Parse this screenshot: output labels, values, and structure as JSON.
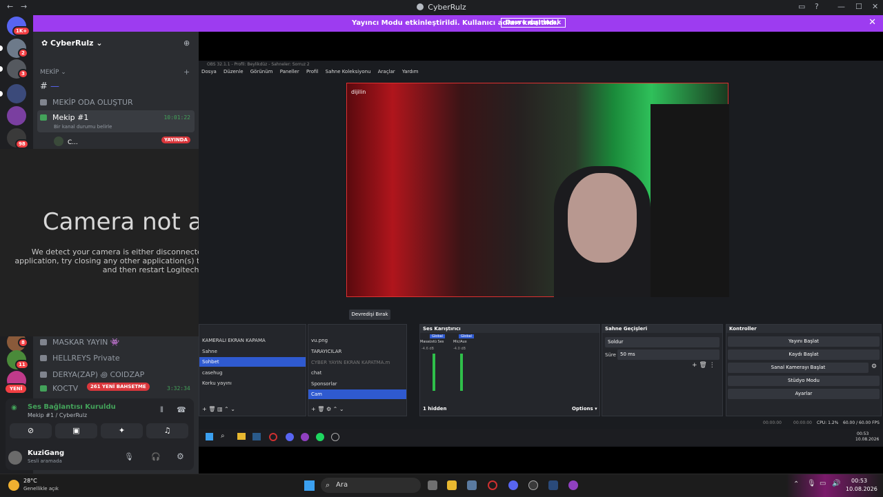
{
  "window": {
    "title": "CyberRulz"
  },
  "banner": {
    "text": "Yayıncı Modu etkinleştirildi. Kullanıcı adları kısaltıldı.",
    "button": "Devre dışı bırak"
  },
  "rail": {
    "badges": [
      "1K+",
      "2",
      "3",
      "8",
      "11",
      "98"
    ],
    "yeni": "YENİ"
  },
  "server": {
    "name": "CyberRulz",
    "category": "MEKİP",
    "hash_channel": "—",
    "channels": [
      {
        "label": "MEKİP ODA OLUŞTUR"
      },
      {
        "label": "Mekip #1",
        "time": "10:01:22",
        "status": "Bir kanal durumu belirle"
      }
    ],
    "live_user": "C...",
    "live_badge": "YAYINDA",
    "lower_channels": [
      {
        "label": "MASKAR YAYIN 👾"
      },
      {
        "label": "HELLREYS Private"
      },
      {
        "label": "DERYA(ZAP) ꩜ COIDZAP"
      },
      {
        "label": "KOCTV",
        "time": "3:32:34"
      }
    ],
    "new_members": "261 YENİ BAHSETME"
  },
  "camera": {
    "title": "Camera not available",
    "message": "We detect your camera is either disconnected or being used by another application, try closing any other application(s) that might be using your camera and then restart Logitech Capture."
  },
  "voice": {
    "status": "Ses Bağlantısı Kuruldu",
    "location": "Mekip #1 / CyberRulz"
  },
  "user": {
    "name": "KuziGang",
    "status": "Sesli aramada"
  },
  "obs": {
    "title": "OBS 32.1.1 - Profil: Beylikdüz - Sahneler: Sorruz 2",
    "menu": [
      "Dosya",
      "Düzenle",
      "Görünüm",
      "Paneller",
      "Profil",
      "Sahne Koleksiyonu",
      "Araçlar",
      "Yardım"
    ],
    "watermark": "dijilin",
    "devredigi": "Devredişi Bırak",
    "scenes": [
      "KAMERALI EKRAN KAPAMA",
      "Sahne",
      "Sohbet",
      "casehug",
      "Korku yayını"
    ],
    "selected_scene": "Sohbet",
    "sources": [
      "vu.png",
      "TARAYICILAR",
      "CYBER YAYIN EKRAN KAPATMA.m",
      "chat",
      "Sponsorlar",
      "Cam"
    ],
    "selected_source": "Cam",
    "mixer_title": "Ses Karıştırıcı",
    "mixer_channels": [
      {
        "name": "Masaüstü Ses",
        "tag": "Global",
        "db": "-4.6 dB"
      },
      {
        "name": "Mic/Aux",
        "tag": "Global",
        "db": "-4.0 dB"
      }
    ],
    "hidden": "1 hidden",
    "options": "Options",
    "transitions": {
      "title": "Sahne Geçişleri",
      "type": "Soldur",
      "duration_label": "Süre",
      "duration": "50 ms"
    },
    "controls": {
      "title": "Kontroller",
      "buttons": [
        "Yayını Başlat",
        "Kaydı Başlat",
        "Sanal Kamerayı Başlat",
        "Stüdyo Modu",
        "Ayarlar"
      ]
    },
    "status": {
      "time1": "00:00:00",
      "time2": "00:00:00",
      "cpu": "CPU: 1.2%",
      "fps": "60.00 / 60.00 FPS"
    },
    "inner_clock": {
      "time": "00:53",
      "date": "10.08.2026"
    }
  },
  "taskbar": {
    "weather_temp": "28°C",
    "weather_desc": "Genellikle açık",
    "search": "Ara",
    "clock_time": "00:53",
    "clock_date": "10.08.2026"
  }
}
